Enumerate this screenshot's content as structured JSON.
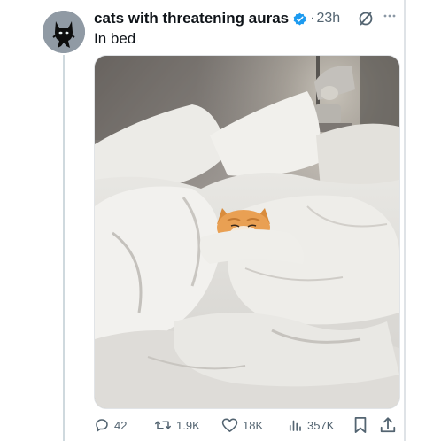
{
  "tweet": {
    "display_name": "cats with threatening auras",
    "separator": "·",
    "time": "23h",
    "text": "In bed",
    "avatar_icon": "black-cat-avatar",
    "verified_icon": "verified-badge-icon",
    "media_alt_icon": "cat-in-bed-photo"
  },
  "actions": {
    "replies": "42",
    "reposts": "1.9K",
    "likes": "18K",
    "views": "357K"
  },
  "colors": {
    "verified_blue": "#1d9bf0",
    "muted_text": "#536471",
    "primary_text": "#0f1419",
    "thread_line": "#cfd9de"
  }
}
